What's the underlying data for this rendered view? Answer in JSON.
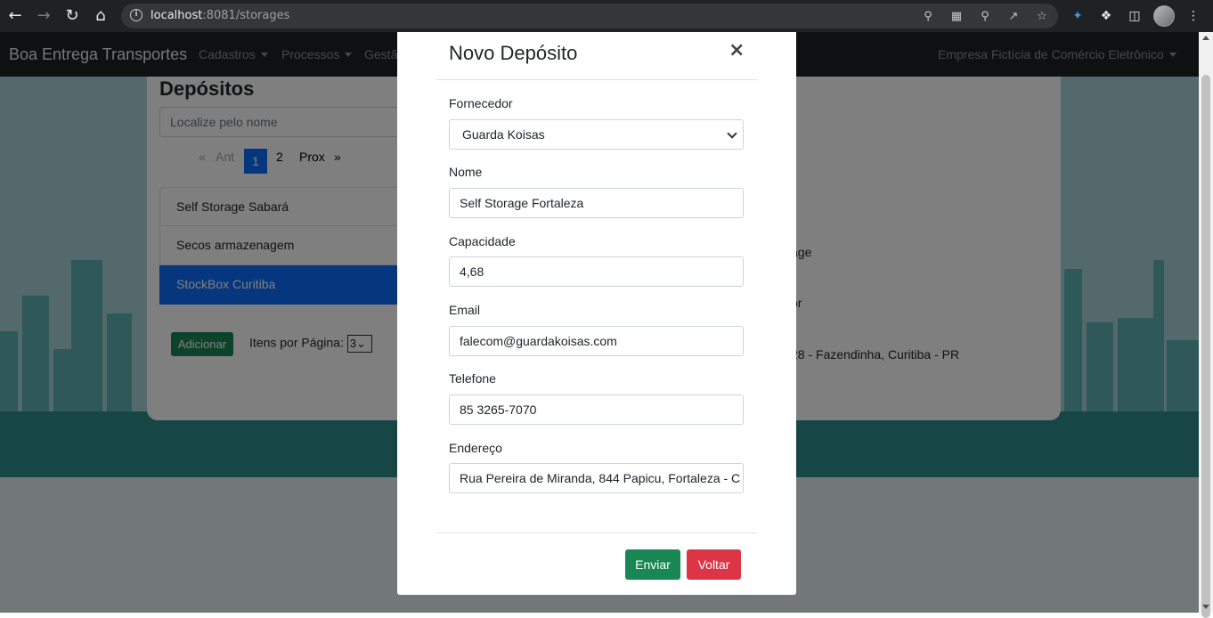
{
  "browser": {
    "url_host": "localhost",
    "url_path": ":8081/storages"
  },
  "navbar": {
    "brand": "Boa Entrega Transportes",
    "menus": [
      "Cadastros",
      "Processos",
      "Gestã"
    ],
    "company": "Empresa Fictícia de Comércio Eletrônico"
  },
  "page": {
    "title": "Depósitos",
    "search_placeholder": "Localize pelo nome",
    "pagination": {
      "first": "«",
      "prev": "Ant",
      "pages": [
        "1",
        "2"
      ],
      "current": "1",
      "next": "Prox",
      "last": "»"
    },
    "storages": [
      "Self Storage Sabará",
      "Secos armazenagem",
      "StockBox Curitiba"
    ],
    "selected_storage": "StockBox Curitiba",
    "add_button": "Adicionar",
    "per_page_label": "Itens por Página:",
    "per_page_value": "3",
    "details": {
      "fragment1": "age",
      "fragment2": "or",
      "address_fragment": "28 - Fazendinha, Curitiba - PR"
    }
  },
  "modal": {
    "title": "Novo Depósito",
    "close": "×",
    "fields": {
      "supplier_label": "Fornecedor",
      "supplier_value": "Guarda Koisas",
      "name_label": "Nome",
      "name_value": "Self Storage Fortaleza",
      "capacity_label": "Capacidade",
      "capacity_value": "4,68",
      "email_label": "Email",
      "email_value": "falecom@guardakoisas.com",
      "phone_label": "Telefone",
      "phone_value": "85 3265-7070",
      "address_label": "Endereço",
      "address_value": "Rua Pereira de Miranda, 844 Papicu, Fortaleza - C"
    },
    "submit_button": "Enviar",
    "back_button": "Voltar"
  },
  "colors": {
    "primary": "#0d6efd",
    "success": "#198754",
    "danger": "#dc3545",
    "navbar": "#1d2124"
  }
}
